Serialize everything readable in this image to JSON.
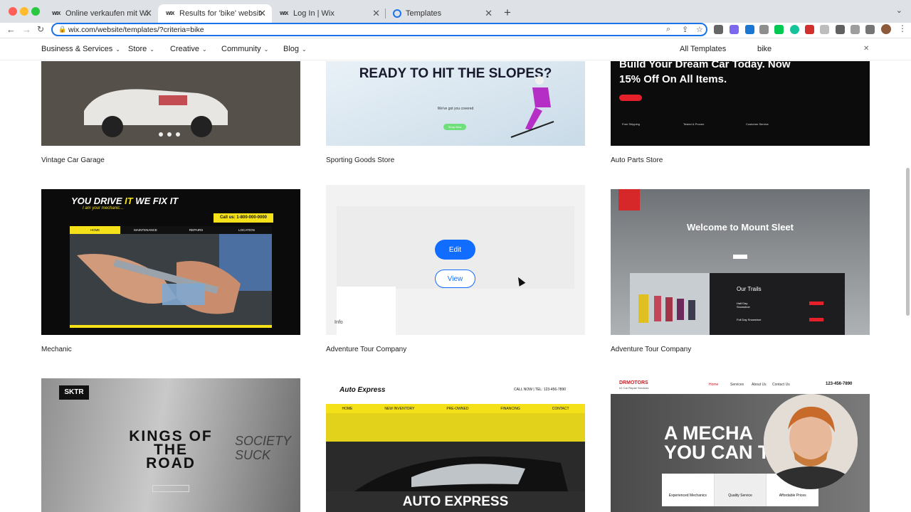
{
  "browser": {
    "tabs": [
      {
        "label": "Online verkaufen mit Wix eCom",
        "favicon": "wix-favicon"
      },
      {
        "label": "Results for 'bike' website temp",
        "favicon": "wix-favicon",
        "active": true
      },
      {
        "label": "Log In | Wix",
        "favicon": "wix-favicon"
      },
      {
        "label": "Templates",
        "favicon": "google-favicon"
      }
    ],
    "favicon_text": "WIX",
    "url": "wix.com/website/templates/?criteria=bike"
  },
  "nav": {
    "categories": [
      "Business & Services",
      "Store",
      "Creative",
      "Community",
      "Blog"
    ],
    "all_templates": "All Templates",
    "search_value": "bike"
  },
  "cards": [
    {
      "title": "Vintage Car Garage"
    },
    {
      "title": "Sporting Goods Store",
      "headline": "READY TO HIT THE SLOPES?",
      "sub": "We've got you covered",
      "btn": "Shop Now"
    },
    {
      "title": "Auto Parts Store",
      "headline": "Build Your Dream Car Today. Now 15% Off On All Items.",
      "features": [
        "Free Shipping",
        "Tested & Proven",
        "Customer Service"
      ]
    },
    {
      "title": "Mechanic",
      "headline1": "YOU DRIVE ",
      "headline_accent": "IT",
      "headline2": " WE FIX IT",
      "sub": "I am your mechanic...",
      "call": "Call us: 1-800-000-0000",
      "menu": [
        "HOME",
        "MAINTENANCE",
        "REPAIRS",
        "LOCATION"
      ]
    },
    {
      "title": "Adventure Tour Company",
      "edit": "Edit",
      "view": "View",
      "info": "Info"
    },
    {
      "title": "Adventure Tour Company",
      "headline": "Welcome to Mount Sleet",
      "trails": "Our Trails",
      "trail1": "Half Day Snowshoe",
      "trail2": "Full Day Snowshoe"
    },
    {
      "title": "",
      "logo": "SKTR",
      "headline": "KINGS OF THE ROAD",
      "scribble": "SOCIETY SUCK"
    },
    {
      "title": "",
      "logo": "Auto Express",
      "call": "CALL NOW | TEL: 123-456-7890",
      "menu": [
        "HOME",
        "NEW INVENTORY",
        "PRE-OWNED",
        "FINANCING",
        "CONTACT"
      ],
      "footer": "AUTO EXPRESS"
    },
    {
      "title": "",
      "logo": "DRMOTORS",
      "tagline": "#1 Car Repair Services",
      "menu": [
        "Home",
        "Services",
        "About Us",
        "Contact Us"
      ],
      "phone": "123-456-7890",
      "headline": "A MECHA YOU CAN T",
      "features": [
        "Experienced Mechanics",
        "Quality Service",
        "Affordable Prices"
      ]
    }
  ],
  "colors": {
    "wix_blue": "#116dff",
    "mechanic_yellow": "#f5e11a",
    "auto_red": "#e5202a"
  }
}
